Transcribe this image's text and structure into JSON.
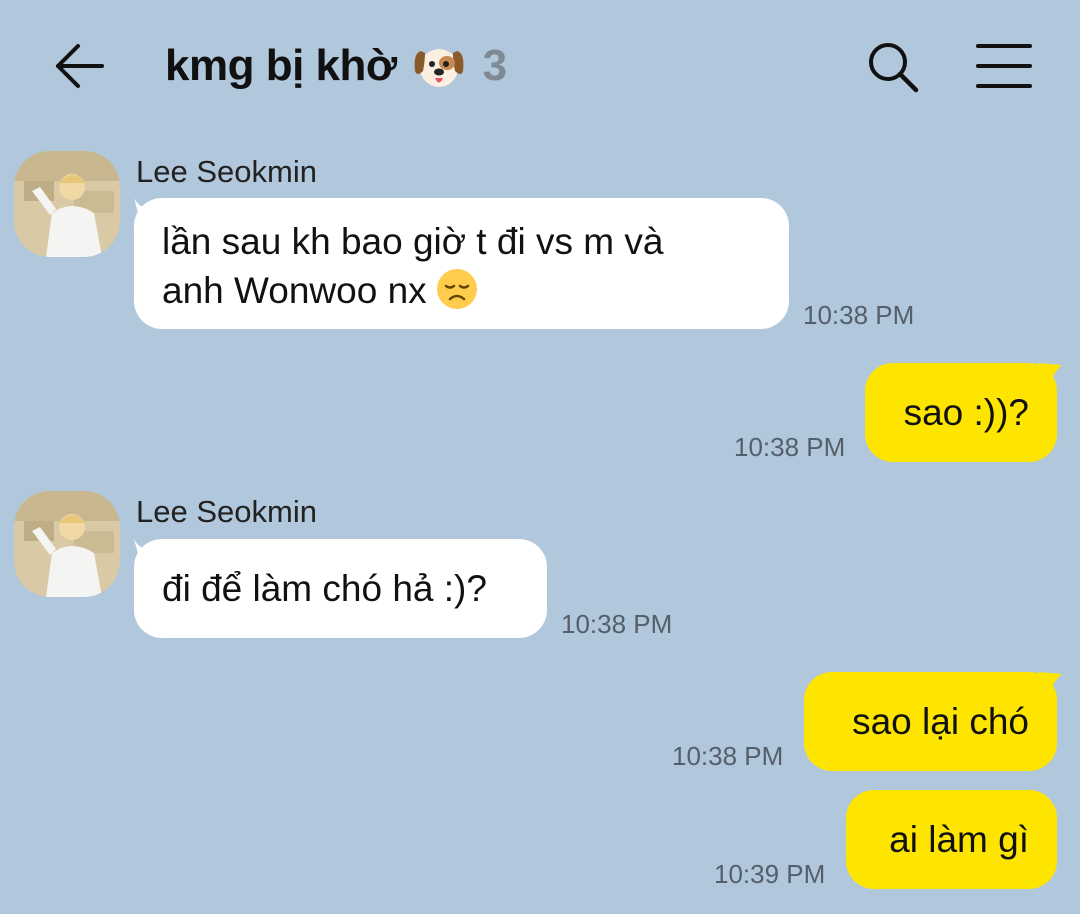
{
  "header": {
    "title": "kmg bị khờ",
    "title_emoji": "dog-face-emoji",
    "member_count": "3",
    "back_icon": "back-arrow-icon",
    "search_icon": "search-icon",
    "menu_icon": "hamburger-menu-icon"
  },
  "colors": {
    "background": "#b1c7dc",
    "incoming_bubble": "#ffffff",
    "outgoing_bubble": "#fee500",
    "timestamp": "#555f69"
  },
  "messages": [
    {
      "direction": "incoming",
      "sender": "Lee Seokmin",
      "lines": [
        "lần sau kh bao giờ t đi vs m và",
        "anh Wonwoo nx"
      ],
      "emoji": "disappointed-face-emoji",
      "time": "10:38 PM"
    },
    {
      "direction": "outgoing",
      "text": "sao :))?",
      "time": "10:38 PM"
    },
    {
      "direction": "incoming",
      "sender": "Lee Seokmin",
      "text": "đi để làm chó hả :)?",
      "time": "10:38 PM"
    },
    {
      "direction": "outgoing",
      "text": "sao lại chó",
      "time": "10:38 PM"
    },
    {
      "direction": "outgoing",
      "text": "ai làm gì",
      "time": "10:39 PM"
    }
  ]
}
